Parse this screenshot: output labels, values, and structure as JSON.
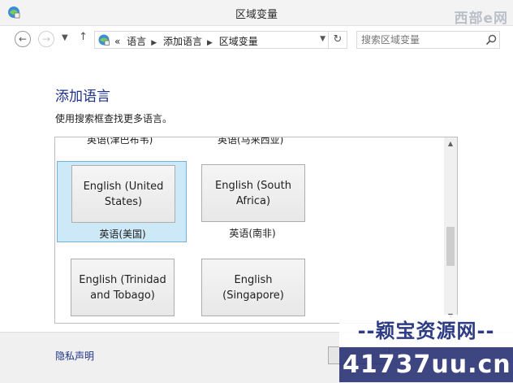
{
  "window": {
    "title": "区域变量"
  },
  "nav": {
    "breadcrumb_prefix": "«",
    "breadcrumbs": [
      "语言",
      "添加语言",
      "区域变量"
    ],
    "search_placeholder": "搜索区域变量"
  },
  "main": {
    "heading": "添加语言",
    "instruction": "使用搜索框查找更多语言。",
    "cut_labels": [
      "英语(津巴布韦)",
      "英语(马来西亚)"
    ],
    "tiles": [
      {
        "button": "English (United States)",
        "label": "英语(美国)",
        "selected": true
      },
      {
        "button": "English (South Africa)",
        "label": "英语(南非)",
        "selected": false
      },
      {
        "button": "English (Trinidad and Tobago)",
        "label": "",
        "selected": false
      },
      {
        "button": "English (Singapore)",
        "label": "",
        "selected": false
      }
    ]
  },
  "footer": {
    "privacy_link": "隐私声明"
  },
  "watermarks": {
    "top": "西部e网",
    "bottom_line1": "--颖宝资源网--",
    "bottom_line2": "41737uu.cn"
  },
  "colors": {
    "accent": "#1e3287",
    "selected_bg": "#cde8f6",
    "selected_border": "#73b3d9"
  }
}
